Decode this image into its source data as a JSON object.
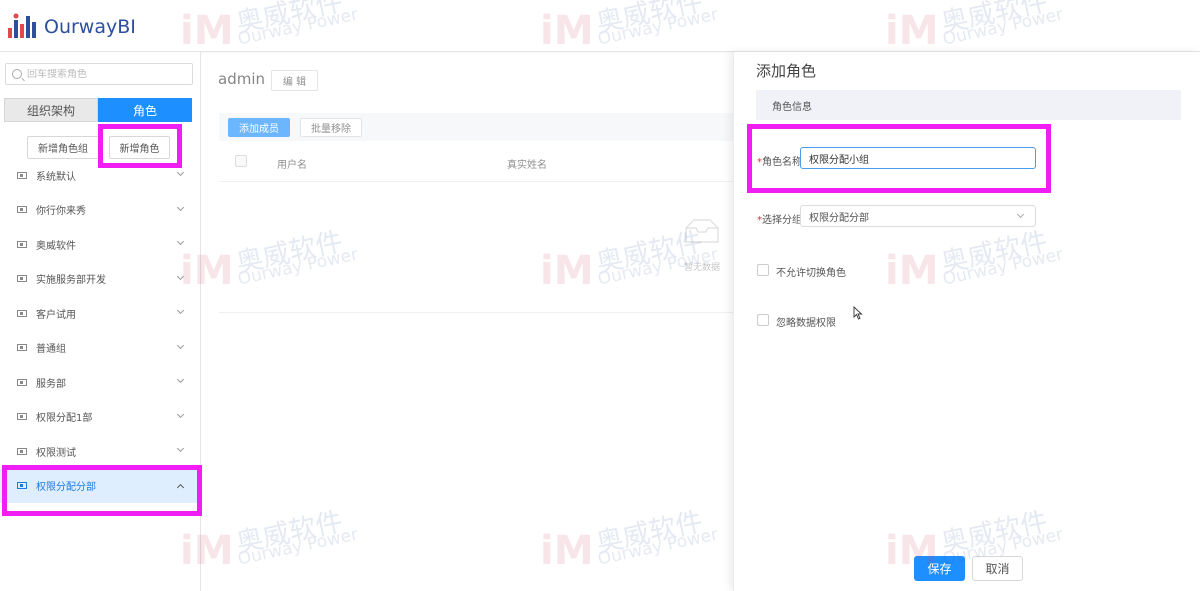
{
  "app": {
    "logo_text": "OurwayBI"
  },
  "sidebar": {
    "search_placeholder": "回车搜索角色",
    "tabs": [
      "组织架构",
      "角色"
    ],
    "btn_new_group": "新增角色组",
    "btn_new_role": "新增角色",
    "items": [
      {
        "label": "系统默认"
      },
      {
        "label": "你行你来秀"
      },
      {
        "label": "奥威软件"
      },
      {
        "label": "实施服务部开发"
      },
      {
        "label": "客户试用"
      },
      {
        "label": "普通组"
      },
      {
        "label": "服务部"
      },
      {
        "label": "权限分配1部"
      },
      {
        "label": "权限测试"
      },
      {
        "label": "权限分配分部"
      }
    ]
  },
  "main": {
    "title": "admin",
    "btn_edit": "编 辑",
    "btn_add_member": "添加成员",
    "btn_batch_remove": "批量移除",
    "columns": [
      "用户名",
      "真实姓名"
    ],
    "empty_text": "暂无数据"
  },
  "drawer": {
    "title": "添加角色",
    "section": "角色信息",
    "name_label": "角色名称:",
    "name_value": "权限分配小组",
    "group_label": "选择分组:",
    "group_value": "权限分配分部",
    "cb_no_switch": "不允许切换角色",
    "cb_ignore_perm": "忽略数据权限",
    "btn_save": "保存",
    "btn_cancel": "取消"
  },
  "watermark": {
    "cn": "奥威软件",
    "en": "Ourway Power"
  },
  "colors": {
    "primary": "#1e8fff",
    "highlight": "#f01df5",
    "selected_bg": "#dfeeff"
  }
}
